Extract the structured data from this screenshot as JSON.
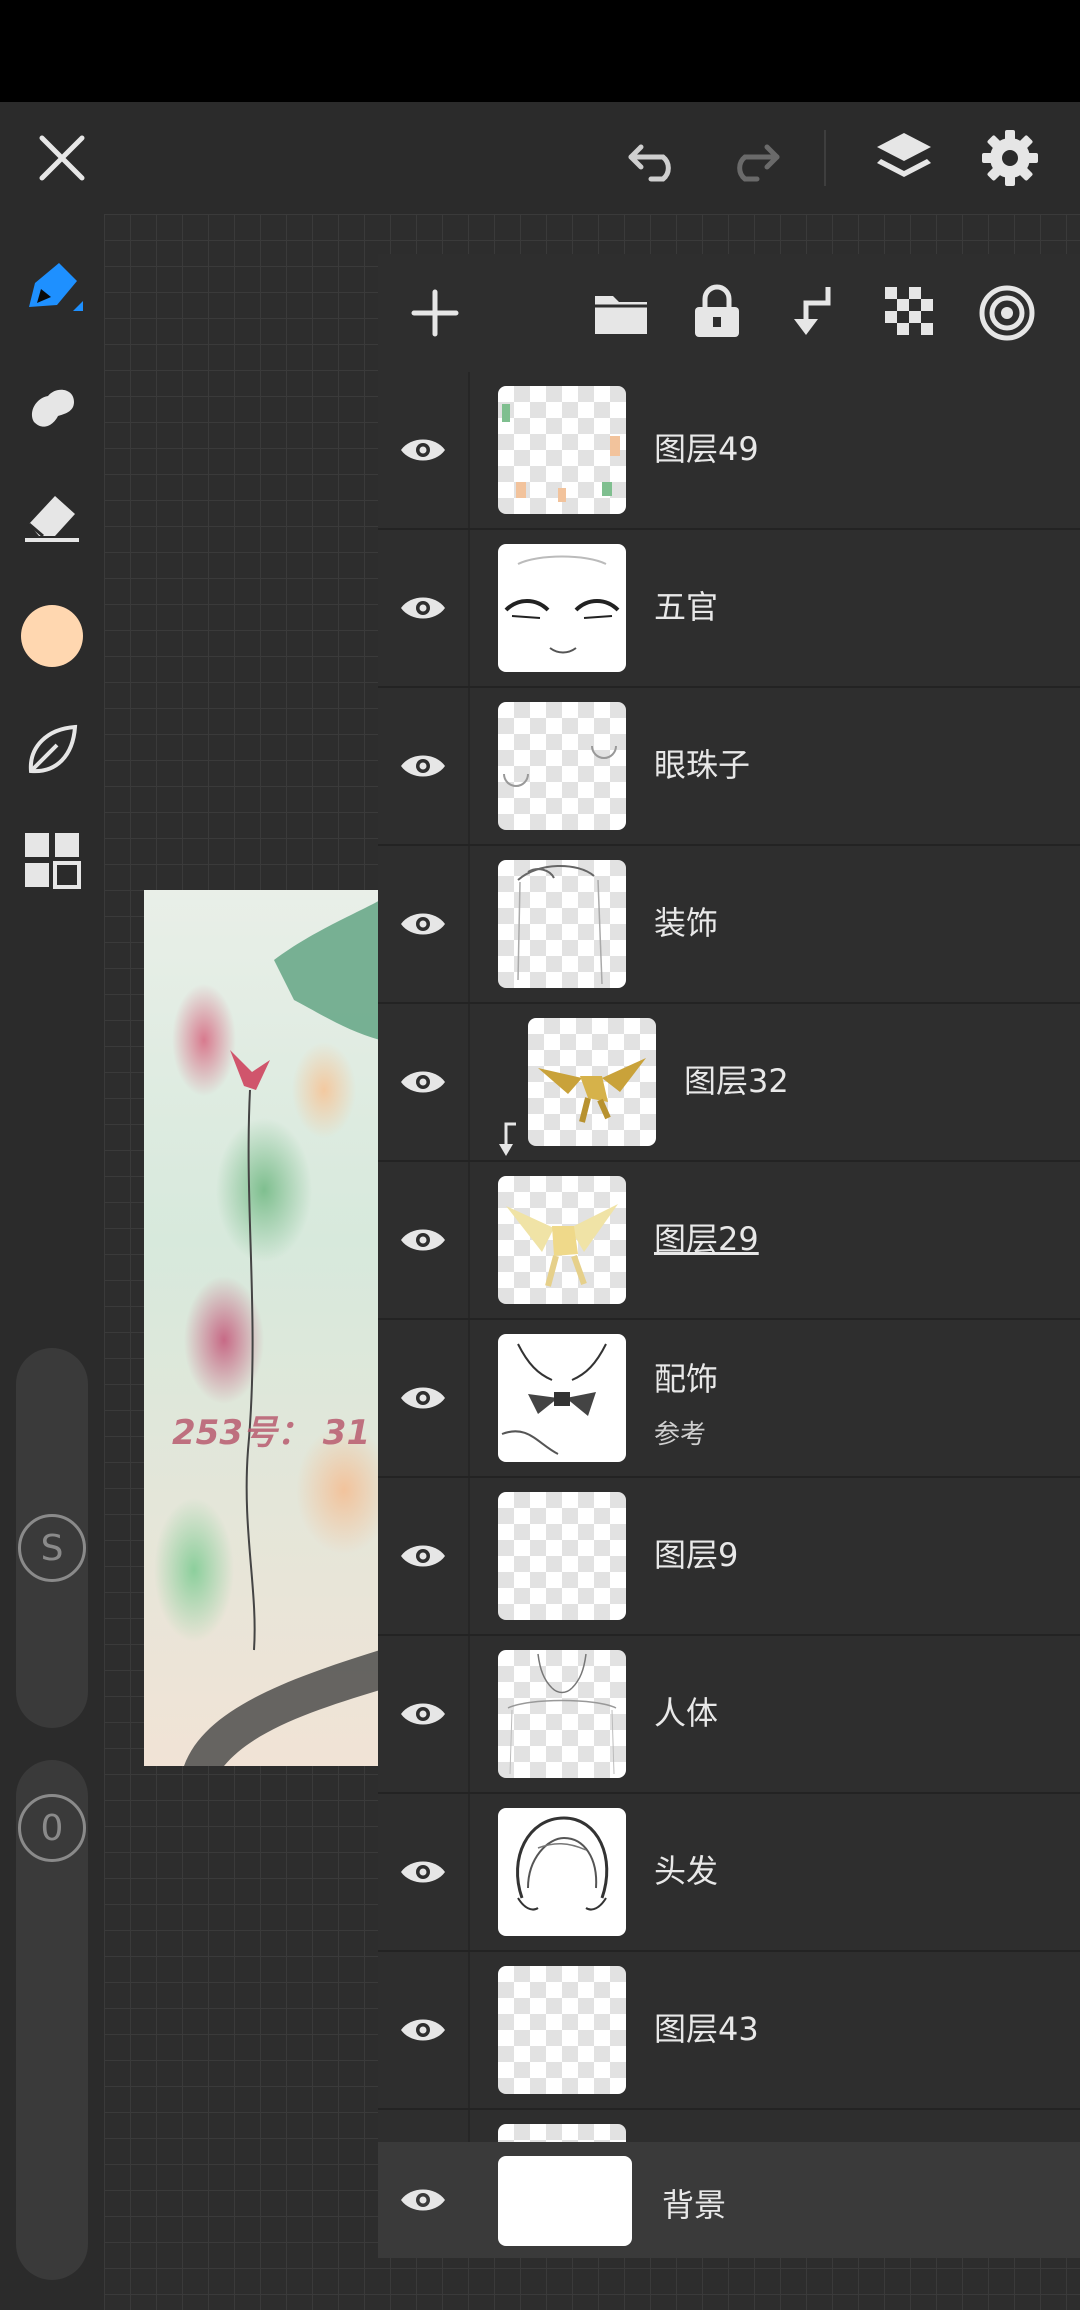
{
  "topbar": {
    "close_icon": "close-icon",
    "undo_icon": "undo-icon",
    "redo_icon": "redo-icon",
    "layers_icon": "layers-icon",
    "settings_icon": "gear-icon"
  },
  "tools": {
    "current_color": "#FFD7B0",
    "accent_color": "#1E90FF",
    "size_slider_label": "S",
    "opacity_slider_label": "0"
  },
  "artwork": {
    "watermark": "253号： 31"
  },
  "layers_panel": {
    "layers": [
      {
        "name": "图层49"
      },
      {
        "name": "五官"
      },
      {
        "name": "眼珠子"
      },
      {
        "name": "装饰"
      },
      {
        "name": "图层32",
        "clipped": true
      },
      {
        "name": "图层29",
        "selected": true
      },
      {
        "name": "配饰",
        "sub": "参考"
      },
      {
        "name": "图层9"
      },
      {
        "name": "人体"
      },
      {
        "name": "头发"
      },
      {
        "name": "图层43"
      }
    ],
    "background_name": "背景"
  }
}
